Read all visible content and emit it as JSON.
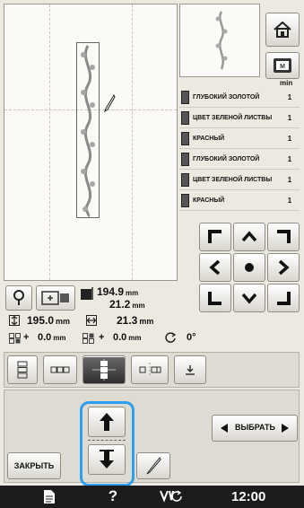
{
  "thread_list": {
    "min_header": "min",
    "items": [
      {
        "name": "ГЛУБОКИЙ ЗОЛОТОЙ",
        "min": "1"
      },
      {
        "name": "ЦВЕТ ЗЕЛЕНОЙ ЛИСТВЫ",
        "min": "1"
      },
      {
        "name": "КРАСНЫЙ",
        "min": "1"
      },
      {
        "name": "ГЛУБОКИЙ ЗОЛОТОЙ",
        "min": "1"
      },
      {
        "name": "ЦВЕТ ЗЕЛЕНОЙ ЛИСТВЫ",
        "min": "1"
      },
      {
        "name": "КРАСНЫЙ",
        "min": "1"
      }
    ]
  },
  "size": {
    "width": "194.9",
    "height": "21.2",
    "unit": "mm"
  },
  "position": {
    "height_value": "195.0",
    "width_value": "21.3",
    "unit": "mm",
    "offset_x": "0.0",
    "offset_y": "0.0",
    "angle": "0°",
    "plus": "+"
  },
  "select": {
    "label": "ВЫБРАТЬ"
  },
  "close": {
    "label": "ЗАКРЫТЬ"
  },
  "statusbar": {
    "time": "12:00"
  },
  "icons": {
    "home": "home-icon",
    "frame": "hoop-icon",
    "arrows": [
      "arrow-up-left",
      "arrow-up",
      "arrow-up-right",
      "arrow-left",
      "center-dot",
      "arrow-right",
      "arrow-down-left",
      "arrow-down",
      "arrow-down-right"
    ]
  },
  "colors": {
    "highlight": "#2e9ff0"
  }
}
